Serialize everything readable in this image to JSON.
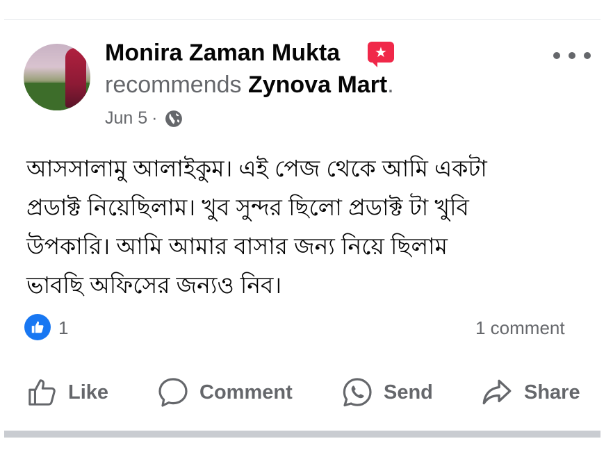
{
  "post": {
    "author": "Monira Zaman Mukta",
    "verb": "recommends",
    "page_name": "Zynova Mart",
    "trailing_dot": ".",
    "date": "Jun 5",
    "separator": "·",
    "privacy_icon": "globe-icon",
    "badge_icon": "star-speech-icon",
    "text_lines": [
      "আসসালামু আলাইকুম।  এই পেজ থেকে আমি একটা",
      "প্রডাক্ট নিয়েছিলাম।  খুব সুন্দর ছিলো প্রডাক্ট টা খুবি",
      "উপকারি। আমি আমার বাসার জন্য নিয়ে ছিলাম",
      "ভাবছি অফিসের জন্যও নিব।"
    ]
  },
  "stats": {
    "reaction_icon": "like-reaction-icon",
    "like_count": "1",
    "comment_count": "1 comment"
  },
  "actions": {
    "like": "Like",
    "comment": "Comment",
    "send": "Send",
    "share": "Share"
  },
  "colors": {
    "primary_text": "#050505",
    "secondary_text": "#65676b",
    "like_blue": "#1877f2",
    "badge_red": "#f02849"
  }
}
